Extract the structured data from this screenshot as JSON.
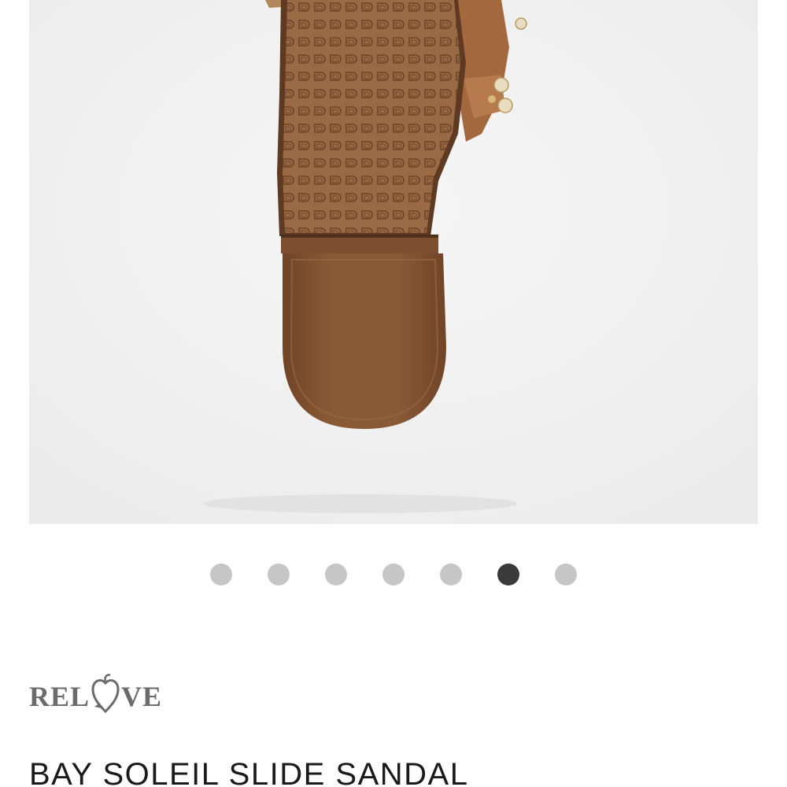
{
  "product": {
    "image_alt": "sandal sole view",
    "title": "BAY SOLEIL SLIDE SANDAL"
  },
  "carousel": {
    "total": 7,
    "active_index": 5
  },
  "brand": {
    "logo_text_left": "REL",
    "logo_text_right": "VE",
    "logo_word": "RELOVE"
  },
  "colors": {
    "dot_inactive": "#c6c6c6",
    "dot_active": "#3a3a3a",
    "sole_brown": "#8a5a36",
    "heel_brown": "#7d4f30",
    "background": "#f2f2f2",
    "logo_gray": "#6b6b6b"
  }
}
